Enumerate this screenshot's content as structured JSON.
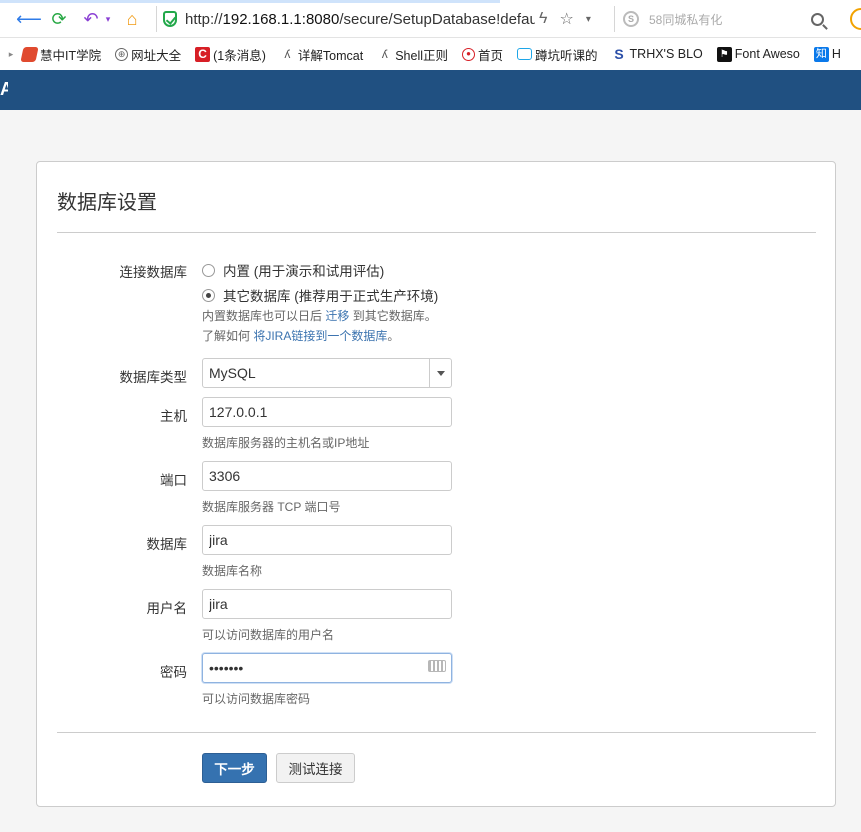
{
  "browser": {
    "url_prefix": "http://",
    "url_host": "192.168.1.1:8080",
    "url_path": "/secure/SetupDatabase!defau",
    "search_placeholder": "58同城私有化"
  },
  "bookmarks": [
    {
      "label": "慧中IT学院",
      "icon": "hz-logo-icon",
      "color": "#e04a2f"
    },
    {
      "label": "网址大全",
      "icon": "globe-icon",
      "color": "#888888"
    },
    {
      "label": "(1条消息)",
      "icon": "csdn-c-icon",
      "color": "#d71f26"
    },
    {
      "label": "详解Tomcat",
      "icon": "tomcat-icon",
      "color": "#555555"
    },
    {
      "label": "Shell正则",
      "icon": "shell-icon",
      "color": "#555555"
    },
    {
      "label": "首页",
      "icon": "weibo-icon",
      "color": "#d71f26"
    },
    {
      "label": "蹲坑听课的",
      "icon": "bilibili-tv-icon",
      "color": "#1ea6e8"
    },
    {
      "label": "TRHX'S BLO",
      "icon": "trhx-s-icon",
      "color": "#2b4fa8"
    },
    {
      "label": "Font Aweso",
      "icon": "flag-icon",
      "color": "#111111"
    },
    {
      "label": "H",
      "icon": "zhihu-icon",
      "color": "#0a79ea",
      "badge": "知"
    }
  ],
  "header": {
    "logo": "A"
  },
  "page": {
    "title": "数据库设置",
    "connection": {
      "label": "连接数据库",
      "options": [
        {
          "label": "内置 (用于演示和试用评估)",
          "selected": false
        },
        {
          "label": "其它数据库 (推荐用于正式生产环境)",
          "selected": true
        }
      ],
      "help1_pre": "内置数据库也可以日后 ",
      "help1_link": "迁移",
      "help1_post": " 到其它数据库。",
      "help2_pre": "了解如何 ",
      "help2_link": "将JIRA链接到一个数据库",
      "help2_post": "。"
    },
    "db_type": {
      "label": "数据库类型",
      "value": "MySQL"
    },
    "host": {
      "label": "主机",
      "value": "127.0.0.1",
      "help": "数据库服务器的主机名或IP地址"
    },
    "port": {
      "label": "端口",
      "value": "3306",
      "help": "数据库服务器 TCP 端口号"
    },
    "database": {
      "label": "数据库",
      "value": "jira",
      "help": "数据库名称"
    },
    "username": {
      "label": "用户名",
      "value": "jira",
      "help": "可以访问数据库的用户名"
    },
    "password": {
      "label": "密码",
      "value": "•••••••",
      "help": "可以访问数据库密码"
    },
    "buttons": {
      "next": "下一步",
      "test": "测试连接"
    }
  }
}
